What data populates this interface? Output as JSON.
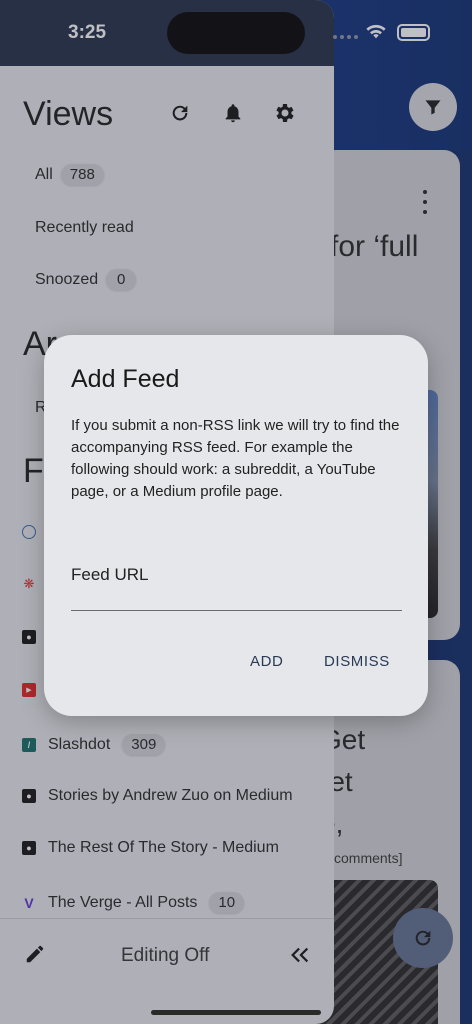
{
  "status_bar": {
    "time": "3:25"
  },
  "drawer": {
    "views_title": "Views",
    "views": [
      {
        "label": "All",
        "count": "788"
      },
      {
        "label": "Recently read",
        "count": ""
      },
      {
        "label": "Snoozed",
        "count": "0"
      }
    ],
    "archives_title_visible": "Ar",
    "archive_item_visible": "R",
    "feeds_title_visible": "F",
    "feeds": [
      {
        "label": "Slashdot",
        "count": "309",
        "icon": "slashdot-icon",
        "color": "#0f6a63"
      },
      {
        "label": "Stories by Andrew Zuo on Medium",
        "count": "",
        "icon": "medium-icon",
        "color": "#111111"
      },
      {
        "label": "The Rest Of The Story - Medium",
        "count": "",
        "icon": "medium-icon",
        "color": "#111111"
      },
      {
        "label": "The Verge -  All Posts",
        "count": "10",
        "icon": "verge-icon",
        "color": "#5b2ed6"
      }
    ],
    "footer": {
      "label": "Editing Off"
    }
  },
  "background": {
    "card1_title": "for ‘full",
    "card2_line1": "Get",
    "card2_line2": "ret",
    "card2_line3": "e,",
    "card2_meta": "comments]"
  },
  "dialog": {
    "title": "Add Feed",
    "body": "If you submit a non-RSS link we will try to find the accompanying RSS feed. For example the following should work: a subreddit, a YouTube page, or a Medium profile page.",
    "field_label": "Feed URL",
    "field_value": "",
    "add_label": "ADD",
    "dismiss_label": "DISMISS"
  }
}
